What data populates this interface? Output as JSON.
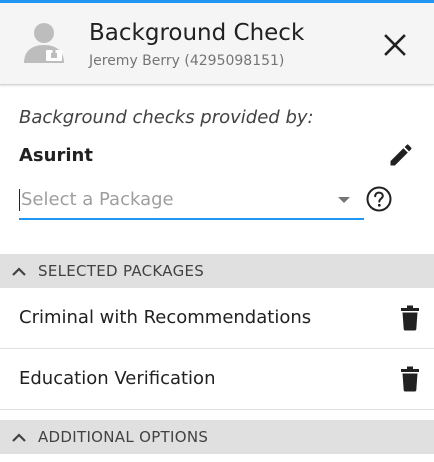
{
  "header": {
    "title": "Background Check",
    "subtitle": "Jeremy Berry (4295098151)",
    "avatar_icon": "person-badge-icon",
    "close_icon": "close-icon"
  },
  "provider": {
    "provided_by_label": "Background checks provided by:",
    "name": "Asurint",
    "edit_icon": "pencil-icon"
  },
  "package_select": {
    "placeholder": "Select a Package",
    "value": "",
    "help_icon": "help-circle-icon"
  },
  "selected_packages": {
    "header": "SELECTED PACKAGES",
    "items": [
      {
        "name": "Criminal with Recommendations"
      },
      {
        "name": "Education Verification"
      }
    ]
  },
  "additional_options": {
    "header": "ADDITIONAL OPTIONS"
  },
  "colors": {
    "accent": "#2196f3",
    "header_bg": "#f5f5f5",
    "section_bg": "#e0e0e0"
  }
}
